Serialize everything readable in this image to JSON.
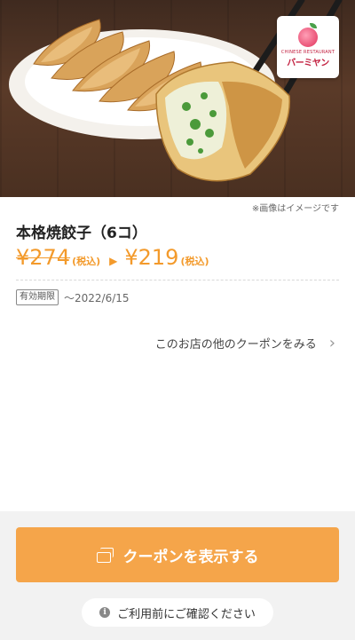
{
  "hero": {
    "logo": {
      "name": "バーミヤン",
      "subtitle": "CHINESE RESTAURANT"
    }
  },
  "image_note": "※画像はイメージです",
  "product": {
    "title": "本格焼餃子（6コ）",
    "old_price": "¥274",
    "new_price": "¥219",
    "tax_label": "(税込)",
    "arrow": "▶"
  },
  "validity": {
    "label": "有効期限",
    "date": "〜2022/6/15"
  },
  "other_coupons": {
    "label": "このお店の他のクーポンをみる",
    "chevron": "›"
  },
  "footer": {
    "show_button_label": "クーポンを表示する",
    "confirm_label": "ご利用前にご確認ください",
    "info_glyph": "i"
  },
  "colors": {
    "accent": "#f5a54a",
    "price": "#f39a2b",
    "footer_bg": "#f2f2f2",
    "logo_red": "#c21f3f"
  },
  "icons": {
    "coupon": "coupon-icon",
    "info": "info-icon",
    "chevron": "chevron-right-icon",
    "logo": "peach-logo-icon"
  }
}
